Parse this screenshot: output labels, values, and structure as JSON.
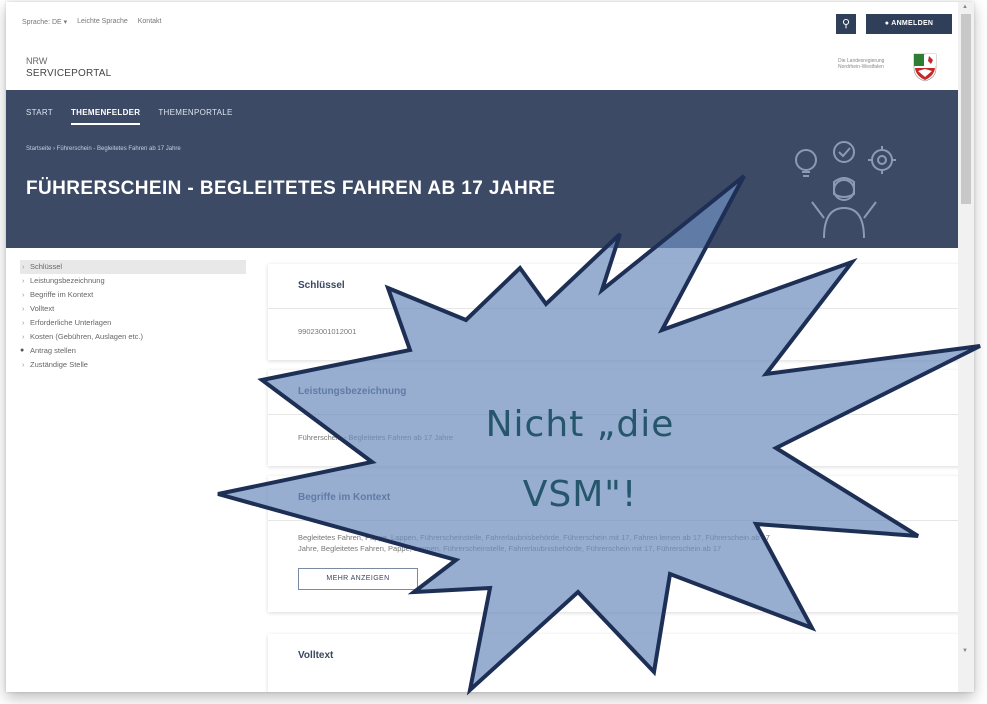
{
  "utility": {
    "links": [
      "Sprache: DE ▾",
      "Leichte Sprache",
      "Kontakt"
    ],
    "search_icon": "search-icon",
    "login_label": "ANMELDEN"
  },
  "brand": {
    "nrw": "NRW",
    "portal": "SERVICEPORTAL",
    "land_text": "Die Landesregierung Nordrhein-Westfalen"
  },
  "nav": {
    "items": [
      "START",
      "THEMENFELDER",
      "THEMENPORTALE"
    ],
    "active": "THEMENFELDER"
  },
  "breadcrumb": "Startseite › Führerschein - Begleitetes Fahren ab 17 Jahre",
  "page_title": "FÜHRERSCHEIN - BEGLEITETES FAHREN AB 17 JAHRE",
  "sidebar": {
    "items": [
      {
        "label": "Schlüssel"
      },
      {
        "label": "Leistungsbezeichnung"
      },
      {
        "label": "Begriffe im Kontext"
      },
      {
        "label": "Volltext"
      },
      {
        "label": "Erforderliche Unterlagen"
      },
      {
        "label": "Kosten (Gebühren, Auslagen etc.)"
      },
      {
        "label": "Antrag stellen"
      },
      {
        "label": "Zuständige Stelle"
      }
    ]
  },
  "cards": {
    "schluessel": {
      "title": "Schlüssel",
      "value": "99023001012001"
    },
    "leistung": {
      "title": "Leistungsbezeichnung",
      "value": "Führerschein - Begleitetes Fahren ab 17 Jahre"
    },
    "begriffe": {
      "title": "Begriffe im Kontext",
      "line1": "Begleitetes Fahren, Pappe, Lappen, Führerscheinstelle, Fahrerlaubnisbehörde, Führerschein mit 17, Fahren lernen ab 17, Führerschein ab 17",
      "line2": "Jahre, Begleitetes Fahren, Pappe, Lappen, Führerscheinstelle, Fahrerlaubnisbehörde, Führerschein mit 17, Führerschein ab 17",
      "button": "MEHR ANZEIGEN"
    },
    "volltext": {
      "title": "Volltext"
    }
  },
  "annotation": {
    "line1": "Nicht „die",
    "line2": "VSM\"!",
    "fill": "#6f8fbf",
    "stroke": "#1e2f55"
  },
  "colors": {
    "hero": "#3c4a65",
    "button": "#2f3f5a"
  }
}
